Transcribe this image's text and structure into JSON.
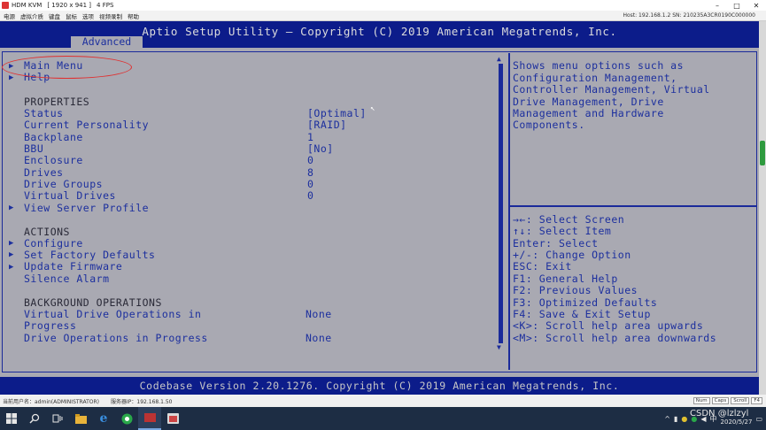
{
  "kvm": {
    "title": "HDM KVM",
    "resolution": "[ 1920 x 941 ]",
    "fps": "4 FPS",
    "menu": [
      "电源",
      "虚拟介质",
      "键盘",
      "鼠标",
      "选项",
      "视频录制",
      "帮助"
    ],
    "ip_info": "Host: 192.168.1.2   SN: 210235A3CR0190C000000",
    "status_user": "当前用户名：admin(ADMINISTRATOR)",
    "status_ip": "服务器IP：192.168.1.50",
    "status_buttons": [
      "Num",
      "Caps",
      "Scroll",
      "F4"
    ]
  },
  "bios": {
    "title": "Aptio Setup Utility – Copyright (C) 2019 American Megatrends, Inc.",
    "tab": "Advanced",
    "footer": "Codebase Version 2.20.1276. Copyright (C) 2019 American Megatrends, Inc.",
    "menu_top": [
      "Main Menu",
      "Help"
    ],
    "properties_header": "PROPERTIES",
    "properties": [
      {
        "label": "Status",
        "value": "[Optimal]"
      },
      {
        "label": "Current Personality",
        "value": "[RAID]"
      },
      {
        "label": "Backplane",
        "value": "1"
      },
      {
        "label": "BBU",
        "value": "[No]"
      },
      {
        "label": "Enclosure",
        "value": "0"
      },
      {
        "label": "Drives",
        "value": "8"
      },
      {
        "label": "Drive Groups",
        "value": "0"
      },
      {
        "label": "Virtual Drives",
        "value": "0"
      }
    ],
    "view_server_profile": "View Server Profile",
    "actions_header": "ACTIONS",
    "actions": [
      "Configure",
      "Set Factory Defaults",
      "Update Firmware"
    ],
    "silence_alarm": "Silence Alarm",
    "background_header": "BACKGROUND OPERATIONS",
    "bg_ops": [
      {
        "label_line1": "Virtual Drive Operations in",
        "label_line2": "Progress",
        "value": "None"
      },
      {
        "label_line1": "Drive Operations in Progress",
        "value": "None"
      }
    ],
    "help_text": [
      "Shows menu options such as",
      "Configuration Management,",
      "Controller Management, Virtual",
      "Drive Management, Drive",
      "Management and Hardware",
      "Components."
    ],
    "keys": [
      "→←: Select Screen",
      "↑↓: Select Item",
      "Enter: Select",
      "+/-: Change Option",
      "ESC: Exit",
      "F1: General Help",
      "F2: Previous Values",
      "F3: Optimized Defaults",
      "F4: Save & Exit Setup",
      "<K>: Scroll help area upwards",
      "<M>: Scroll help area downwards"
    ]
  },
  "taskbar": {
    "date": "2020/5/27",
    "ime": "中",
    "watermark": "CSDN @lzlzyl"
  },
  "colors": {
    "bios_bg": "#a9a9b2",
    "bios_blue": "#0c1c8a",
    "bios_text": "#1c2f9e",
    "highlight": "#e03030"
  }
}
